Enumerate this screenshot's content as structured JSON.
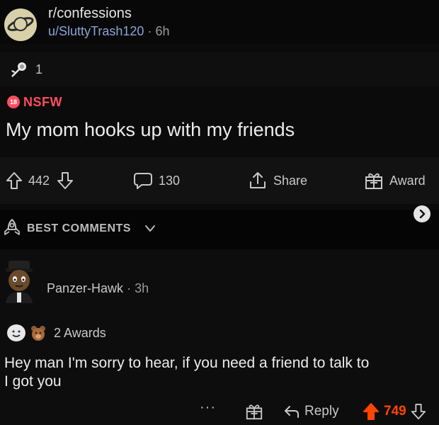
{
  "post": {
    "subreddit": "r/confessions",
    "author": "u/SluttyTrash120",
    "separator": "·",
    "age": "6h",
    "award_count": "1",
    "nsfw_badge": "18",
    "nsfw_label": "NSFW",
    "title": "My mom hooks up with my friends"
  },
  "actions": {
    "upvotes": "442",
    "comments": "130",
    "share_label": "Share",
    "award_label": "Award"
  },
  "sort": {
    "label": "BEST COMMENTS"
  },
  "comment": {
    "username": "PanzerHawk",
    "username_display": "Panzer-Hawk",
    "separator": "·",
    "age": "3h",
    "awards_label": "2 Awards",
    "body": "Hey man I'm sorry to hear, if you need a friend to talk to\nI got you",
    "more_label": "···",
    "reply_label": "Reply",
    "score": "749"
  },
  "colors": {
    "background": "#0b0b0b",
    "nsfw": "#ff4d5f",
    "upvote": "#ff4500",
    "link": "#8ba4d6"
  },
  "icons": {
    "subreddit": "saturn-planet-icon",
    "award": "rose-award-icon",
    "upvote": "arrow-up-icon",
    "downvote": "arrow-down-icon",
    "comment": "speech-bubble-icon",
    "share": "share-icon",
    "gift": "gift-icon",
    "sort": "rocket-icon",
    "chevron": "chevron-down-icon",
    "next": "chevron-right-icon",
    "reply": "reply-arrow-icon"
  }
}
